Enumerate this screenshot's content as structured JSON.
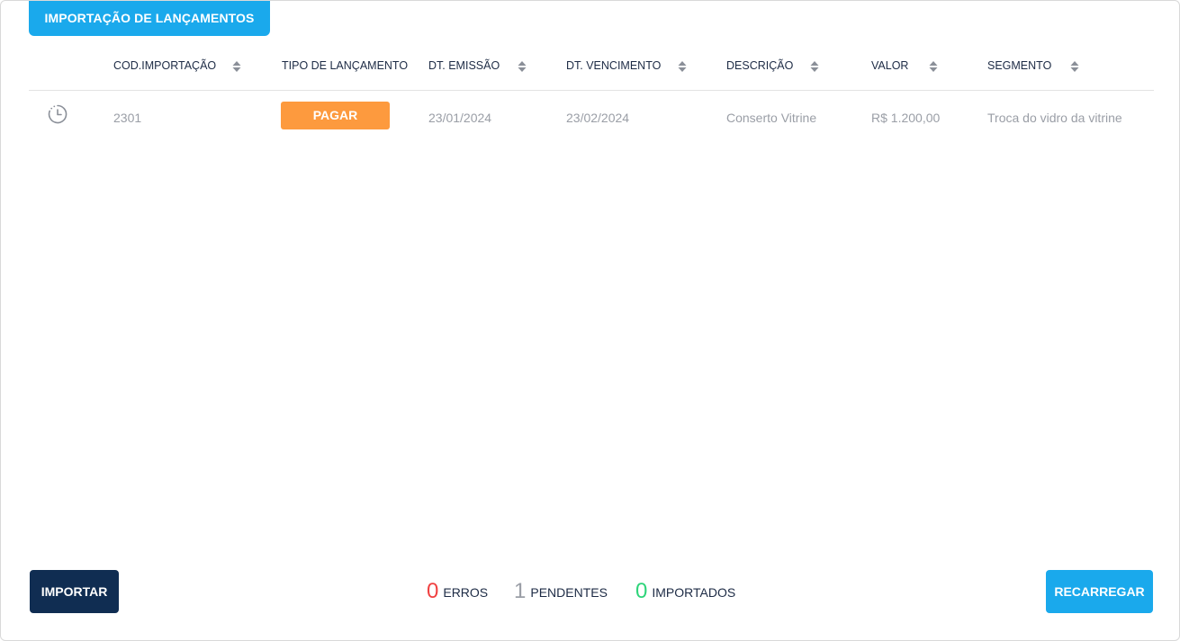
{
  "title": "IMPORTAÇÃO DE LANÇAMENTOS",
  "table": {
    "columns": [
      {
        "label": "COD.IMPORTAÇÃO",
        "sortable": true
      },
      {
        "label": "TIPO DE LANÇAMENTO",
        "sortable": false
      },
      {
        "label": "DT. EMISSÃO",
        "sortable": true
      },
      {
        "label": "DT. VENCIMENTO",
        "sortable": true
      },
      {
        "label": "DESCRIÇÃO",
        "sortable": true
      },
      {
        "label": "VALOR",
        "sortable": true
      },
      {
        "label": "SEGMENTO",
        "sortable": true
      }
    ],
    "rows": [
      {
        "status_icon": "clock-pending-icon",
        "cod": "2301",
        "tipo": "PAGAR",
        "emissao": "23/01/2024",
        "vencimento": "23/02/2024",
        "descricao": "Conserto Vitrine",
        "valor": "R$ 1.200,00",
        "segmento": "Troca do vidro da vitrine"
      }
    ]
  },
  "footer": {
    "import_label": "IMPORTAR",
    "reload_label": "RECARREGAR",
    "summary": {
      "errors": {
        "count": "0",
        "label": "ERROS"
      },
      "pending": {
        "count": "1",
        "label": "PENDENTES"
      },
      "imported": {
        "count": "0",
        "label": "IMPORTADOS"
      }
    }
  },
  "colors": {
    "accent": "#1aa9ec",
    "primary_dark": "#102d52",
    "badge_pagar": "#fd9a3e",
    "error": "#f04141",
    "pending": "#9a9ea6",
    "success": "#2ed47a"
  }
}
